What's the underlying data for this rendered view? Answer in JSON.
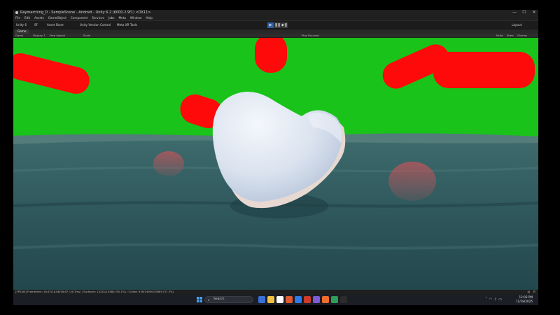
{
  "window": {
    "title": "Raymarching_D - SampleScene - Android - Unity 6.2 (6000.2.9f1) <DX11>",
    "controls": [
      "—",
      "☐",
      "✕"
    ]
  },
  "menu": [
    "File",
    "Edit",
    "Assets",
    "GameObject",
    "Component",
    "Services",
    "Jobs",
    "Meta",
    "Window",
    "Help"
  ],
  "toolbar": {
    "account": "Unity 6",
    "user": "SF",
    "asset_store": "Asset Store",
    "version_control": "Unity Version Control",
    "xr": "Meta XR Tools",
    "layout": "Layout",
    "play_buttons": [
      "▶",
      "❚❚",
      "▶❚"
    ]
  },
  "tabs": {
    "game": "Game"
  },
  "game_bar": {
    "mode": "Game",
    "display": "Display 1",
    "aspect": "Free Aspect",
    "scale": "Scale",
    "play_focused": "Play Focused",
    "mute": "Mute",
    "stats": "Stats",
    "gizmos": "Gizmos"
  },
  "status": {
    "text": "[FPS:60] Frametime: 16.67/16.68/16.67 (16.7ms)  | Surfaces: 14241/14980 (95.1%) | Culled: 939/14900/15669 (37.3%)"
  },
  "taskbar": {
    "search_label": "Search",
    "icon_colors": [
      "#3a6fd8",
      "#f2c043",
      "#ffffff",
      "#e2592f",
      "#2f7ae5",
      "#cc3a2a",
      "#7b5cd6",
      "#ee6c2c",
      "#2e9d5a",
      "#2c2c2c"
    ],
    "time": "12:03 PM",
    "date": "11/18/2025"
  },
  "scene": {
    "sky_color": "#19c31a",
    "blob_color": "#ff0a0a",
    "water_color": "#2f585c",
    "object_color": "#dfe7f2"
  }
}
